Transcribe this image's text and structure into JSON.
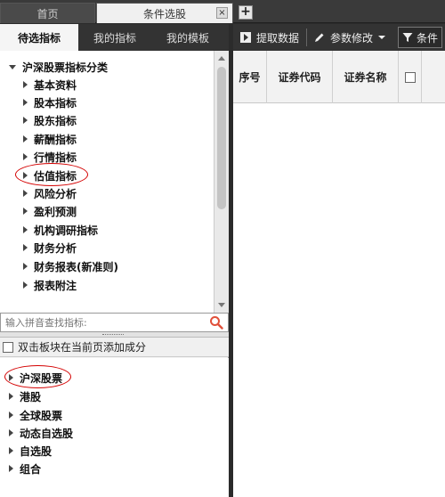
{
  "tabs": [
    {
      "label": "首页"
    },
    {
      "label": "条件选股",
      "close": "×"
    }
  ],
  "tab_add": "+",
  "subtabs": [
    {
      "label": "待选指标"
    },
    {
      "label": "我的指标"
    },
    {
      "label": "我的模板"
    }
  ],
  "indicator_tree": {
    "root": "沪深股票指标分类",
    "items": [
      "基本资料",
      "股本指标",
      "股东指标",
      "薪酬指标",
      "行情指标",
      "估值指标",
      "风险分析",
      "盈利预测",
      "机构调研指标",
      "财务分析",
      "财务报表(新准则)",
      "报表附注"
    ]
  },
  "search": {
    "placeholder": "输入拼音查找指标:"
  },
  "block_option": {
    "label": "双击板块在当前页添加成分"
  },
  "stock_tree": {
    "items": [
      "沪深股票",
      "港股",
      "全球股票",
      "动态自选股",
      "自选股",
      "组合"
    ]
  },
  "toolbar": {
    "extract_label": "提取数据",
    "params_label": "参数修改",
    "filter_label": "条件"
  },
  "grid": {
    "columns": [
      "序号",
      "证券代码",
      "证券名称"
    ]
  },
  "colors": {
    "highlight_circle": "#d40000",
    "dark_bar": "#333333"
  }
}
